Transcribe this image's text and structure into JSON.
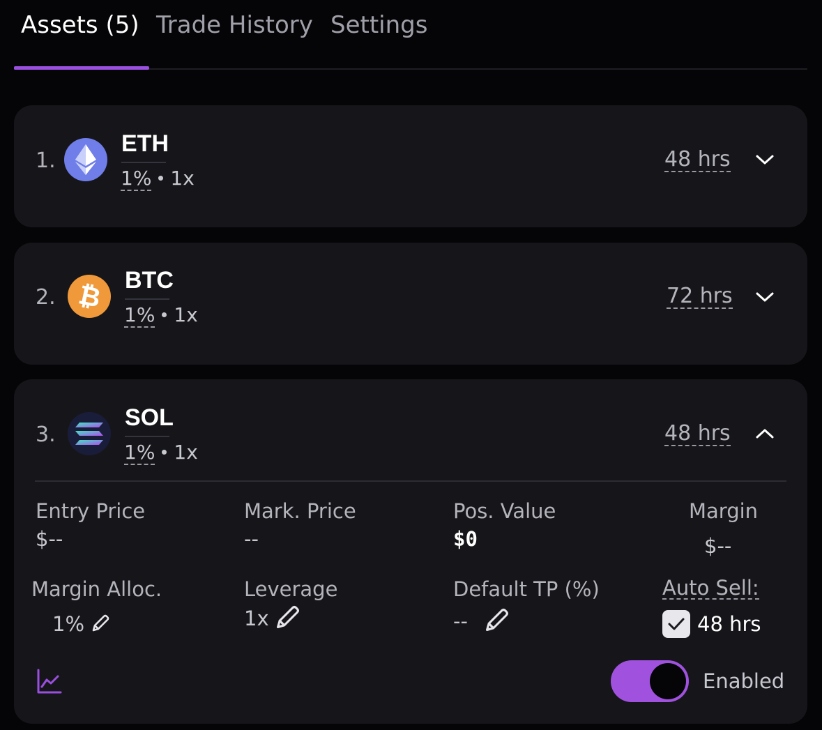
{
  "tabs": [
    {
      "label": "Assets (5)",
      "active": true
    },
    {
      "label": "Trade History",
      "active": false
    },
    {
      "label": "Settings",
      "active": false
    }
  ],
  "assets": [
    {
      "index": "1.",
      "symbol": "ETH",
      "alloc": "1%",
      "leverage": "1x",
      "duration": "48 hrs",
      "icon": "eth-icon",
      "color": "#6f7ee8",
      "expanded": false
    },
    {
      "index": "2.",
      "symbol": "BTC",
      "alloc": "1%",
      "leverage": "1x",
      "duration": "72 hrs",
      "icon": "btc-icon",
      "color": "#f0993a",
      "expanded": false
    },
    {
      "index": "3.",
      "symbol": "SOL",
      "alloc": "1%",
      "leverage": "1x",
      "duration": "48 hrs",
      "icon": "sol-icon",
      "color": "#1a1d3a",
      "expanded": true
    }
  ],
  "details": {
    "entry_price_label": "Entry Price",
    "entry_price_value": "$--",
    "mark_price_label": "Mark. Price",
    "mark_price_value": "--",
    "pos_value_label": "Pos. Value",
    "pos_value_value": "$0",
    "margin_label": "Margin",
    "margin_value": "$--",
    "margin_alloc_label": "Margin Alloc.",
    "margin_alloc_value": "1%",
    "leverage_label": "Leverage",
    "leverage_value": "1x",
    "default_tp_label": "Default TP (%)",
    "default_tp_value": "--",
    "auto_sell_label": "Auto Sell:",
    "auto_sell_value": "48 hrs",
    "auto_sell_checked": true,
    "enabled_label": "Enabled",
    "enabled_on": true
  },
  "colors": {
    "accent": "#9b4fe0",
    "card": "#16161a",
    "background": "#050507"
  }
}
